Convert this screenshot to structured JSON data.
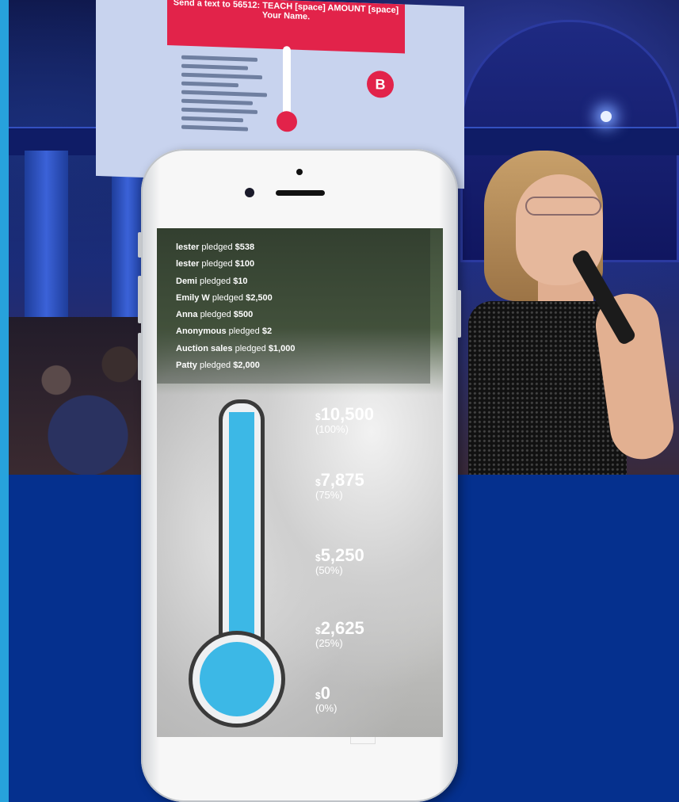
{
  "projected_slide": {
    "banner_text": "Send a text to 56512: TEACH [space] AMOUNT [space] Your Name.",
    "logo_letter": "B"
  },
  "pledge_feed": [
    {
      "name": "lester",
      "verb": "pledged",
      "amount": "$538"
    },
    {
      "name": "lester",
      "verb": "pledged",
      "amount": "$100"
    },
    {
      "name": "Demi",
      "verb": "pledged",
      "amount": "$10"
    },
    {
      "name": "Emily W",
      "verb": "pledged",
      "amount": "$2,500"
    },
    {
      "name": "Anna",
      "verb": "pledged",
      "amount": "$500"
    },
    {
      "name": "Anonymous",
      "verb": "pledged",
      "amount": "$2"
    },
    {
      "name": "Auction sales",
      "verb": "pledged",
      "amount": "$1,000"
    },
    {
      "name": "Patty",
      "verb": "pledged",
      "amount": "$2,000"
    }
  ],
  "thermometer": {
    "fill_percent": 100,
    "fill_color": "#3cb8e6",
    "ticks": [
      {
        "currency": "$",
        "amount": "10,500",
        "percent": "(100%)"
      },
      {
        "currency": "$",
        "amount": "7,875",
        "percent": "(75%)"
      },
      {
        "currency": "$",
        "amount": "5,250",
        "percent": "(50%)"
      },
      {
        "currency": "$",
        "amount": "2,625",
        "percent": "(25%)"
      },
      {
        "currency": "$",
        "amount": "0",
        "percent": "(0%)"
      }
    ]
  },
  "colors": {
    "background": "#05308e",
    "accent_strip": "#27a2dc",
    "slide_banner": "#e2234a"
  }
}
